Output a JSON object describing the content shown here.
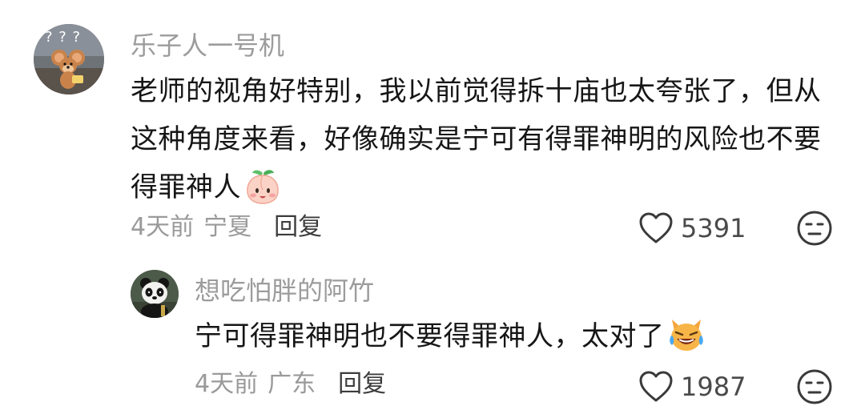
{
  "comments": [
    {
      "avatar": "tom-and-jerry-mouse-avatar",
      "avatar_marks": "? ? ?",
      "username": "乐子人一号机",
      "text_line1": "老师的视角好特别，我以前觉得拆十庙也太夸张了，但从",
      "text_line2": "这种角度来看，好像确实是宁可有得罪神明的风险也不要",
      "text_line3": "得罪神人",
      "emoji": "peach-face-emoji",
      "time": "4天前",
      "location": "宁夏",
      "reply_label": "回复",
      "likes": "5391"
    },
    {
      "avatar": "panda-avatar",
      "username": "想吃怕胖的阿竹",
      "text": "宁可得罪神明也不要得罪神人，太对了",
      "emoji": "crying-laughing-cat-emoji",
      "time": "4天前",
      "location": "广东",
      "reply_label": "回复",
      "likes": "1987"
    }
  ],
  "icons": {
    "like": "heart-outline-icon",
    "dislike": "unamused-face-icon"
  },
  "colors": {
    "username": "#9c9c9c",
    "text": "#161616",
    "meta": "#9a9a9a",
    "icon": "#3a3a3a"
  }
}
